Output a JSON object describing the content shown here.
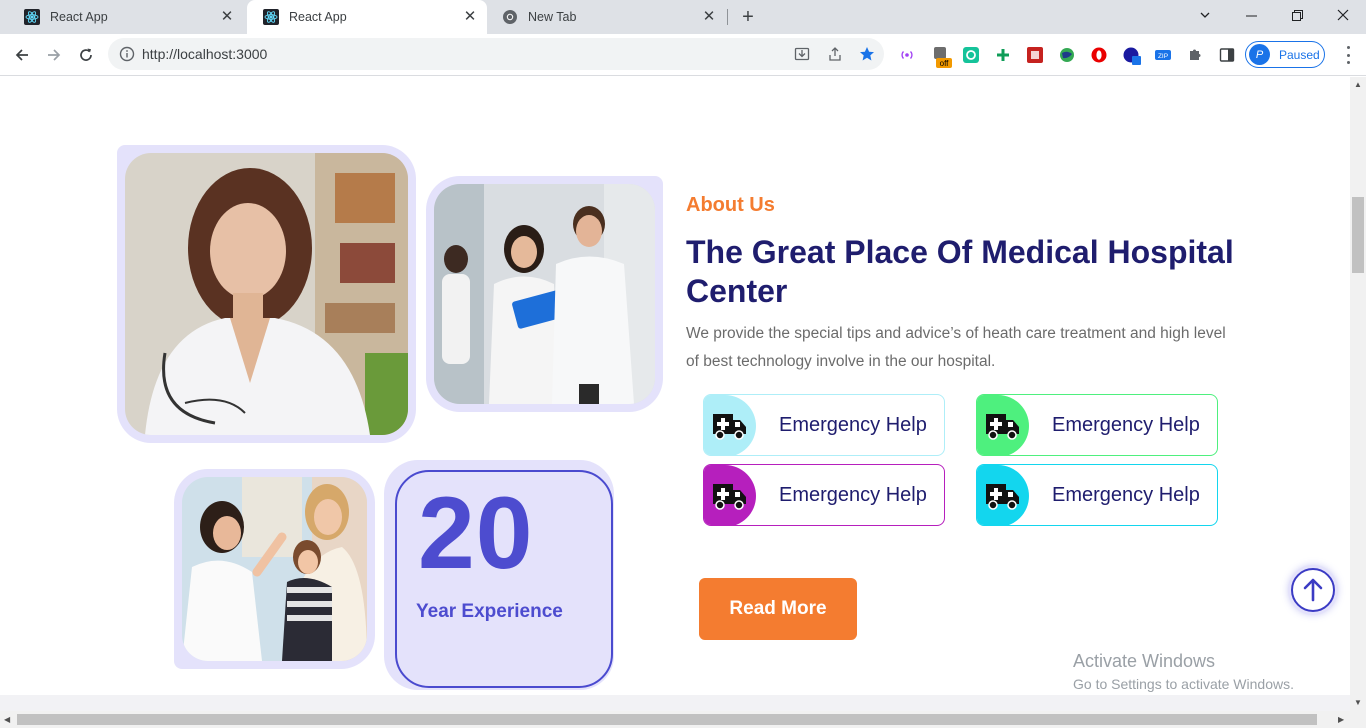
{
  "browser": {
    "tabs": [
      {
        "title": "React App",
        "active": false
      },
      {
        "title": "React App",
        "active": true
      },
      {
        "title": "New Tab",
        "active": false
      }
    ],
    "url": "http://localhost:3000",
    "profile_status": "Paused",
    "profile_initial": "P",
    "extension_badge": "off"
  },
  "about": {
    "kicker": "About Us",
    "title": "The Great Place Of Medical Hospital Center",
    "description": "We provide the special tips and advice’s of heath care treatment and high level of best technology involve in the our hospital.",
    "help_cards": [
      {
        "label": "Emergency Help",
        "color": "#aeeef8"
      },
      {
        "label": "Emergency Help",
        "color": "#4ef07e"
      },
      {
        "label": "Emergency Help",
        "color": "#b61fbd"
      },
      {
        "label": "Emergency Help",
        "color": "#13d6ee"
      }
    ],
    "read_more": "Read More"
  },
  "experience": {
    "number": "20",
    "label": "Year Experience"
  },
  "watermark": {
    "line1": "Activate Windows",
    "line2": "Go to Settings to activate Windows."
  },
  "colors": {
    "accent_orange": "#f47c30",
    "title_navy": "#1f1d6e",
    "experience_blue": "#4d4ccf",
    "frame_lavender": "#e4e2fb"
  }
}
